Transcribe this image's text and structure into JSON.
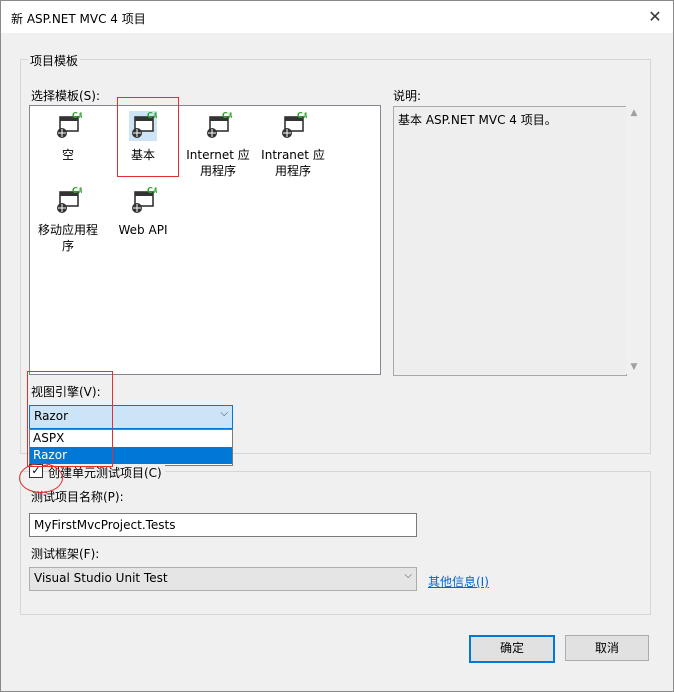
{
  "window": {
    "title": "新 ASP.NET MVC 4 项目",
    "close_glyph": "✕"
  },
  "template_group": {
    "title": "项目模板",
    "select_label": "选择模板(S):",
    "templates": [
      {
        "label": "空",
        "icon": "mvc-project-icon"
      },
      {
        "label": "基本",
        "icon": "mvc-project-icon",
        "selected": true
      },
      {
        "label": "Internet 应用程序",
        "icon": "mvc-project-icon"
      },
      {
        "label": "Intranet 应用程序",
        "icon": "mvc-project-icon"
      },
      {
        "label": "移动应用程序",
        "icon": "mvc-project-icon"
      },
      {
        "label": "Web API",
        "icon": "mvc-project-icon"
      }
    ],
    "description_label": "说明:",
    "description_text": "基本 ASP.NET MVC 4 项目。",
    "view_engine_label": "视图引擎(V):",
    "view_engine_selected": "Razor",
    "view_engine_options": [
      "ASPX",
      "Razor"
    ]
  },
  "test_group": {
    "create_unit_test_label": "创建单元测试项目(C)",
    "create_unit_test_checked": true,
    "project_name_label": "测试项目名称(P):",
    "project_name_value": "MyFirstMvcProject.Tests",
    "framework_label": "测试框架(F):",
    "framework_value": "Visual Studio Unit Test",
    "more_info_link": "其他信息(I)"
  },
  "buttons": {
    "ok": "确定",
    "cancel": "取消"
  },
  "colors": {
    "accent": "#0078d7",
    "annotation": "#e03030",
    "link": "#0066cc"
  }
}
